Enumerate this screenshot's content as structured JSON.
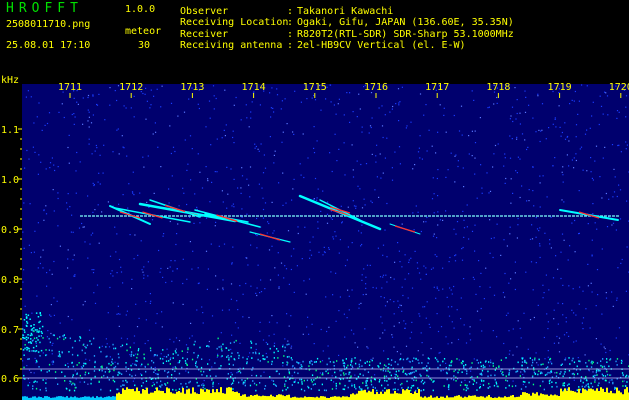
{
  "header": {
    "app_title": "HROFFT",
    "app_version": "1.0.0",
    "file_name": "2508011710.png",
    "mode": "meteor",
    "timestamp": "25.08.01 17:10",
    "count": "30",
    "info": [
      {
        "label": "Observer",
        "sep": ":",
        "value": "Takanori Kawachi"
      },
      {
        "label": "Receiving Location",
        "sep": ":",
        "value": "Ogaki, Gifu, JAPAN (136.60E, 35.35N)"
      },
      {
        "label": "Receiver",
        "sep": ":",
        "value": "R820T2(RTL-SDR) SDR-Sharp 53.1000MHz"
      },
      {
        "label": "Receiving antenna",
        "sep": ":",
        "value": "2el-HB9CV Vertical (el. E-W)"
      }
    ]
  },
  "spectrogram": {
    "y_unit": "kHz",
    "y_ticks": [
      "1.1",
      "1.0",
      "0.9",
      "0.8",
      "0.7",
      "0.6"
    ],
    "x_ticks": [
      "1711",
      "1712",
      "1713",
      "1714",
      "1715",
      "1716",
      "1717",
      "1718",
      "1719",
      "1720"
    ],
    "colors": {
      "bg": "#00006e",
      "noise": "#1a3cff",
      "trace": "#00ffff",
      "hot": "#ff3030",
      "warm": "#ffff00"
    }
  }
}
